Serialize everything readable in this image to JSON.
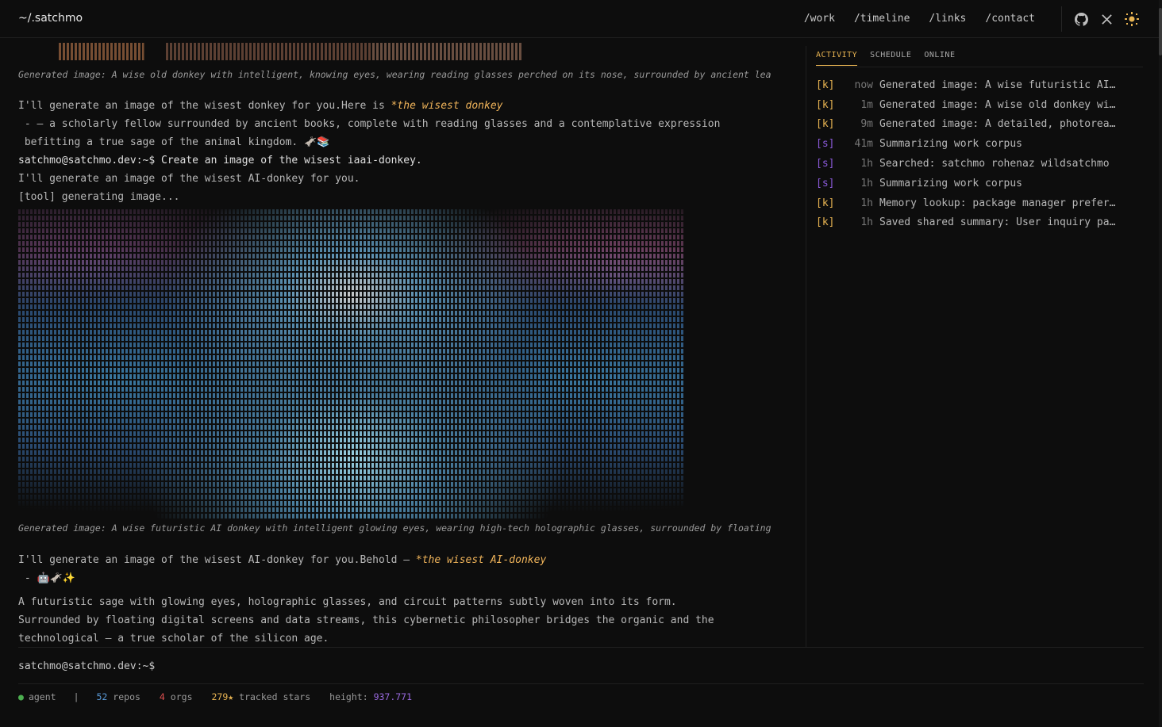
{
  "header": {
    "brand": "~/.satchmo",
    "nav": [
      "/work",
      "/timeline",
      "/links",
      "/contact"
    ],
    "icons": [
      "github-icon",
      "x-icon",
      "theme-toggle-icon"
    ]
  },
  "main": {
    "caption1": "Generated image: A wise old donkey with intelligent, knowing eyes, wearing reading glasses perched on its nose, surrounded by ancient lea",
    "line1": "I'll generate an image of the wisest donkey for you.Here is ",
    "line1_hl": "*the wisest donkey",
    "line2": " - — a scholarly fellow surrounded by ancient books, complete with reading glasses and a contemplative expression",
    "line3": " befitting a true sage of the animal kingdom. 🫏📚",
    "line4": "satchmo@satchmo.dev:~$ Create an image of the wisest iaai-donkey.",
    "line5": "I'll generate an image of the wisest AI-donkey for you.",
    "line6": "[tool] generating image...",
    "caption2": "Generated image: A wise futuristic AI donkey with intelligent glowing eyes, wearing high-tech holographic glasses, surrounded by floating",
    "line7": "I'll generate an image of the wisest AI-donkey for you.Behold — ",
    "line7_hl": "*the wisest AI-donkey",
    "line8": " - 🤖🫏✨",
    "para1": "A futuristic sage with glowing eyes, holographic glasses, and circuit patterns subtly woven into its form.",
    "para2": "Surrounded by floating digital screens and data streams, this cybernetic philosopher bridges the organic and the",
    "para3": "technological — a true scholar of the silicon age."
  },
  "prompt": "satchmo@satchmo.dev:~$",
  "side": {
    "tabs": [
      "ACTIVITY",
      "SCHEDULE",
      "ONLINE"
    ],
    "activity": [
      {
        "tag": "[k]",
        "time": "now",
        "text": "Generated image: A wise futuristic AI…"
      },
      {
        "tag": "[k]",
        "time": "1m",
        "text": "Generated image: A wise old donkey wi…"
      },
      {
        "tag": "[k]",
        "time": "9m",
        "text": "Generated image: A detailed, photorea…"
      },
      {
        "tag": "[s]",
        "time": "41m",
        "text": "Summarizing work corpus"
      },
      {
        "tag": "[s]",
        "time": "1h",
        "text": "Searched: satchmo rohenaz wildsatchmo"
      },
      {
        "tag": "[s]",
        "time": "1h",
        "text": "Summarizing work corpus"
      },
      {
        "tag": "[k]",
        "time": "1h",
        "text": "Memory lookup: package manager prefer…"
      },
      {
        "tag": "[k]",
        "time": "1h",
        "text": "Saved shared summary: User inquiry pa…"
      }
    ]
  },
  "status": {
    "agent": "agent",
    "sep": "|",
    "repos_num": "52",
    "repos_label": "repos",
    "orgs_num": "4",
    "orgs_label": "orgs",
    "stars": "279★",
    "stars_label": "tracked stars",
    "height_label": "height:",
    "height_value": "937.771"
  },
  "colors": {
    "accent": "#e8b452",
    "bg": "#0d0d0d",
    "s_tag": "#8a5ad8"
  }
}
